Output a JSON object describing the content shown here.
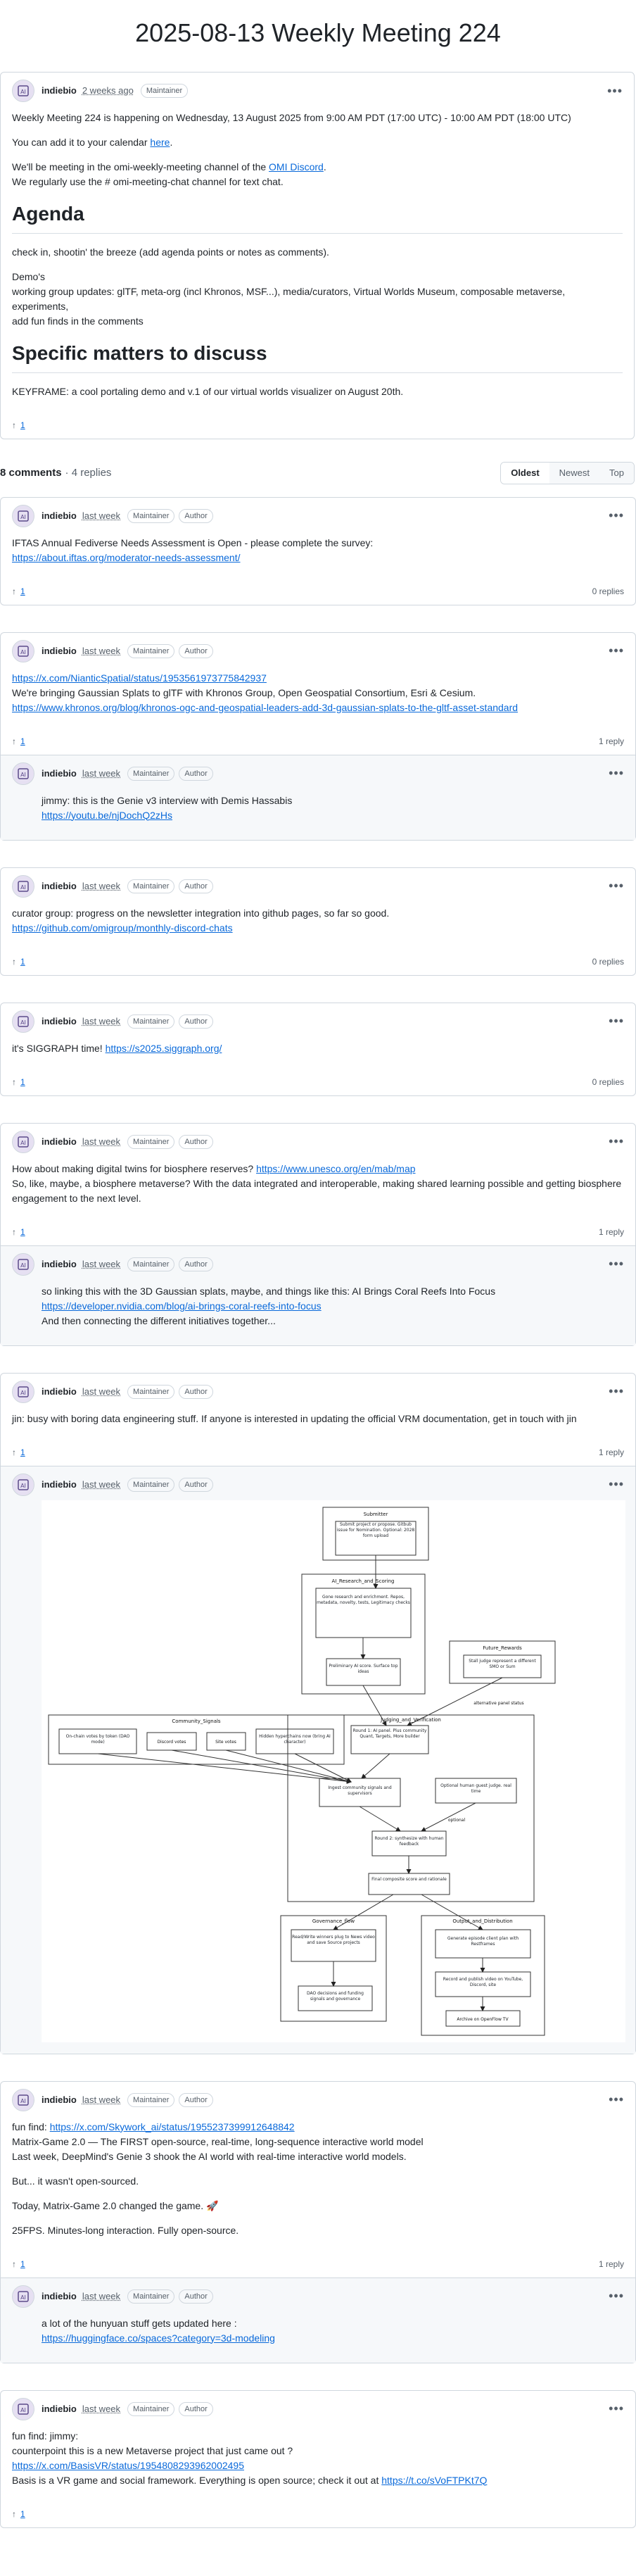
{
  "title": "2025-08-13 Weekly Meeting 224",
  "op": {
    "author": "indiebio",
    "time": "2 weeks ago",
    "badges": [
      "Maintainer"
    ],
    "line1": "Weekly Meeting 224 is happening on Wednesday, 13 August 2025 from 9:00 AM PDT (17:00 UTC) - 10:00 AM PDT (18:00 UTC)",
    "line2a": "You can add it to your calendar ",
    "line2link": "here",
    "line2b": ".",
    "line3a": "We'll be meeting in the omi-weekly-meeting channel of the ",
    "line3link": "OMI Discord",
    "line3b": ".",
    "line4": "We regularly use the # omi-meeting-chat channel for text chat.",
    "h_agenda": "Agenda",
    "agenda1": "check in, shootin' the breeze (add agenda points or notes as comments).",
    "demos": "Demo's",
    "groups": "working group updates: glTF, meta-org (incl Khronos, MSF...), media/curators, Virtual Worlds Museum, composable metaverse, experiments,",
    "addfun": "add fun finds in the comments",
    "h_specific": "Specific matters to discuss",
    "keyframe": "KEYFRAME: a cool portaling demo and v.1 of our virtual worlds visualizer on August 20th.",
    "reactions": "1"
  },
  "summary": {
    "count": "8 comments",
    "replies": "· 4 replies"
  },
  "sort": {
    "oldest": "Oldest",
    "newest": "Newest",
    "top": "Top"
  },
  "labels": {
    "maintainer": "Maintainer",
    "author": "Author",
    "last_week": "last week",
    "name": "indiebio"
  },
  "c1": {
    "text": "IFTAS Annual Fediverse Needs Assessment is Open - please complete the survey:",
    "link": "https://about.iftas.org/moderator-needs-assessment/",
    "reactions": "1",
    "replies": "0 replies"
  },
  "c2": {
    "link1": "https://x.com/NianticSpatial/status/1953561973775842937",
    "text": "We're bringing Gaussian Splats to glTF with Khronos Group, Open Geospatial Consortium, Esri & Cesium.",
    "link2": "https://www.khronos.org/blog/khronos-ogc-and-geospatial-leaders-add-3d-gaussian-splats-to-the-gltf-asset-standard",
    "reactions": "1",
    "replies": "1 reply",
    "r1text": "jimmy: this is the Genie v3 interview with Demis Hassabis",
    "r1link": "https://youtu.be/njDochQ2zHs"
  },
  "c3": {
    "text": "curator group: progress on the newsletter integration into github pages, so far so good.",
    "link": "https://github.com/omigroup/monthly-discord-chats",
    "reactions": "1",
    "replies": "0 replies"
  },
  "c4": {
    "text": "it's SIGGRAPH time! ",
    "link": "https://s2025.siggraph.org/",
    "reactions": "1",
    "replies": "0 replies"
  },
  "c5": {
    "text1": "How about making digital twins for biosphere reserves? ",
    "link1": "https://www.unesco.org/en/mab/map",
    "text2": "So, like, maybe, a biosphere metaverse? With the data integrated and interoperable, making shared learning possible and getting biosphere engagement to the next level.",
    "reactions": "1",
    "replies": "1 reply",
    "r1text": "so linking this with the 3D Gaussian splats, maybe, and things like this: AI Brings Coral Reefs Into Focus",
    "r1link": "https://developer.nvidia.com/blog/ai-brings-coral-reefs-into-focus",
    "r1text2": "And then connecting the different initiatives together..."
  },
  "c6": {
    "text": "jin: busy with boring data engineering stuff. If anyone is interested in updating the official VRM documentation, get in touch with jin",
    "reactions": "1",
    "replies": "1 reply"
  },
  "diagram": {
    "submitter": "Submitter",
    "submit": "Submit project or propose. Gitbub issue for Nomination. Optional: 2028 form upload",
    "aireview": "AI_Research_and_Scoring",
    "research": "Gone research and enrichment. Repos, metadata, novelty, tests, Legitimacy checks",
    "prelim": "Preliminary AI score. Surface top ideas",
    "futurebrand": "Future_Rewards",
    "futurebrand2": "Stall judge represent a different SMO or Sum",
    "altpanel": "alternative panel status",
    "community": "Community_Signals",
    "signal1": "On-chain votes by token (DAO mode)",
    "signal2": "Discord votes",
    "signal3": "Site votes",
    "signal4": "Hidden hyperchains now (bring AI character)",
    "judging": "Judging_and_Verification",
    "round1": "Round 1: AI panel. Plus community Quant, Targets, More builder",
    "ingest": "Ingest community signals and supervisors",
    "optional": "Optional human guest judge. real time",
    "optional2": "optional",
    "round2": "Round 2: synthesize with human feedback",
    "final": "Final composite score and rationale",
    "governance": "Governance_flow",
    "gov1": "Read/Write winners plug to News video and save Source projects",
    "gov2": "DAO decisions and funding signals and governance",
    "output": "Output_and_Distribution",
    "out1": "Generate episode client plan with Restframes",
    "out2": "Record and publish video on YouTube, Discord, site",
    "out3": "Archive on OpenFlow TV"
  },
  "c7": {
    "text1": "fun find: ",
    "link1": "https://x.com/Skywork_ai/status/1955237399912648842",
    "text2": "Matrix-Game 2.0 — The FIRST open-source, real-time, long-sequence interactive world model",
    "text3": "Last week, DeepMind's Genie 3 shook the AI world with real-time interactive world models.",
    "text4": "But... it wasn't open-sourced.",
    "text5": "Today, Matrix-Game 2.0 changed the game. 🚀",
    "text6": "25FPS. Minutes-long interaction. Fully open-source.",
    "reactions": "1",
    "replies": "1 reply",
    "r1text": "a lot of the hunyuan stuff gets updated here :",
    "r1link": "https://huggingface.co/spaces?category=3d-modeling"
  },
  "c8": {
    "text1": "fun find: jimmy:",
    "text2": "counterpoint this is a new Metaverse project that just came out ?",
    "link1": "https://x.com/BasisVR/status/1954808293962002495",
    "text3": "Basis is a VR game and social framework. Everything is open source; check it out at ",
    "link2": "https://t.co/sVoFTPKt7Q",
    "reactions": "1"
  },
  "colors": {
    "link": "#0969da",
    "border": "#d0d7de",
    "muted": "#57606a",
    "reply_bg": "#f6f8fa"
  },
  "icons": {
    "upvote": "arrow-up-icon",
    "more": "kebab-horizontal-icon",
    "avatar": "ai-avatar-icon"
  }
}
